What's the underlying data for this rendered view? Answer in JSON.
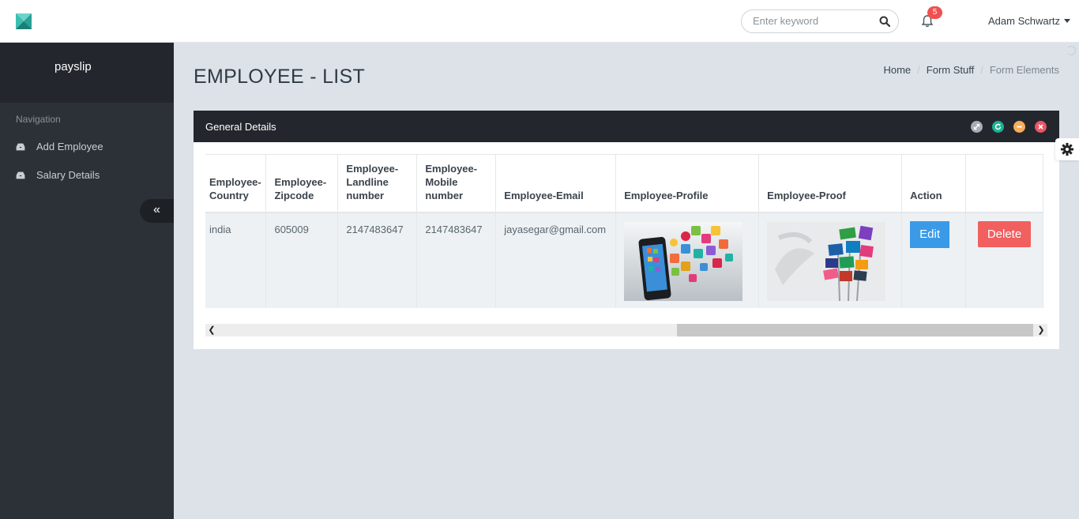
{
  "header": {
    "search_placeholder": "Enter keyword",
    "notification_count": "5",
    "user_name": "Adam Schwartz"
  },
  "sidebar": {
    "brand": "payslip",
    "nav_label": "Navigation",
    "items": [
      {
        "label": "Add Employee",
        "icon": "inbox-icon"
      },
      {
        "label": "Salary Details",
        "icon": "inbox-icon"
      }
    ],
    "collapse_icon": "«"
  },
  "page": {
    "title": "EMPLOYEE - LIST",
    "breadcrumb": [
      "Home",
      "Form Stuff",
      "Form Elements"
    ]
  },
  "panel": {
    "title": "General Details",
    "tool_colors": [
      "#a6adb3",
      "#1ab394",
      "#f8ac59",
      "#ed5565"
    ]
  },
  "table": {
    "headers": [
      "Employee-\nCountry",
      "Employee-\nZipcode",
      "Employee-\nLandline\nnumber",
      "Employee-\nMobile\nnumber",
      "Employee-Email",
      "Employee-Profile",
      "Employee-Proof",
      "Action",
      ""
    ],
    "rows": [
      {
        "country": "india",
        "zipcode": "605009",
        "landline": "2147483647",
        "mobile": "2147483647",
        "email": "jayasegar@gmail.com",
        "profile_image": "smartphone-apps-image",
        "proof_image": "social-media-signs-image",
        "edit_label": "Edit",
        "delete_label": "Delete"
      }
    ]
  },
  "colors": {
    "sidebar_bg": "#2c3138",
    "brand_bg": "#23272d",
    "edit_button": "#3a9ae8",
    "delete_button": "#f15f5f",
    "badge": "#f05050"
  }
}
